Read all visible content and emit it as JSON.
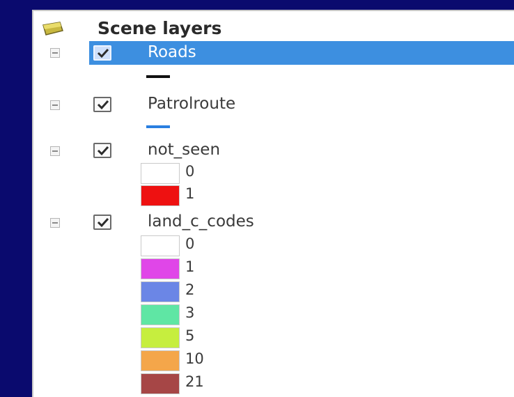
{
  "panel": {
    "root": {
      "label": "Scene layers",
      "icon": "layer-group-icon"
    },
    "layers": [
      {
        "name": "Roads",
        "checked": true,
        "selected": true,
        "symbol": {
          "type": "line",
          "color": "#111111"
        }
      },
      {
        "name": "Patrolroute",
        "checked": true,
        "selected": false,
        "symbol": {
          "type": "line",
          "color": "#2a7fe0"
        }
      },
      {
        "name": "not_seen",
        "checked": true,
        "selected": false,
        "classes": [
          {
            "label": "0",
            "color": "#ffffff"
          },
          {
            "label": "1",
            "color": "#ee1111"
          }
        ]
      },
      {
        "name": "land_c_codes",
        "checked": true,
        "selected": false,
        "classes": [
          {
            "label": "0",
            "color": "#ffffff"
          },
          {
            "label": "1",
            "color": "#e046e8"
          },
          {
            "label": "2",
            "color": "#6b86e6"
          },
          {
            "label": "3",
            "color": "#5fe6a4"
          },
          {
            "label": "5",
            "color": "#c6ee3e"
          },
          {
            "label": "10",
            "color": "#f4a64a"
          },
          {
            "label": "21",
            "color": "#a64646"
          }
        ]
      }
    ]
  },
  "colors": {
    "background": "#0a0a6e",
    "selection": "#3d8fe0"
  }
}
